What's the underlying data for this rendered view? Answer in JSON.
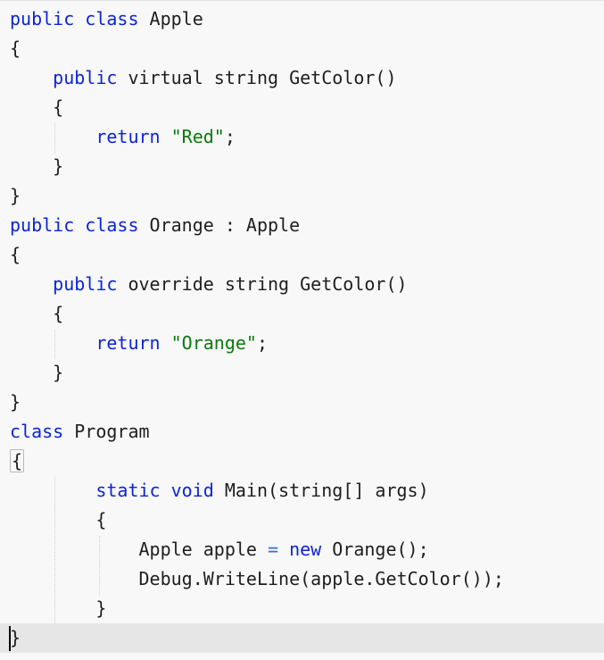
{
  "editor": {
    "lines": [
      {
        "i": 0,
        "tokens": [
          [
            "kw",
            "public"
          ],
          [
            "p",
            " "
          ],
          [
            "kw",
            "class"
          ],
          [
            "p",
            " Apple"
          ]
        ]
      },
      {
        "i": 0,
        "tokens": [
          [
            "p",
            "{"
          ]
        ]
      },
      {
        "i": 1,
        "tokens": [
          [
            "kw",
            "public"
          ],
          [
            "p",
            " virtual string GetColor()"
          ]
        ]
      },
      {
        "i": 1,
        "tokens": [
          [
            "p",
            "{"
          ]
        ]
      },
      {
        "i": 2,
        "tokens": [
          [
            "kw",
            "return"
          ],
          [
            "p",
            " "
          ],
          [
            "str",
            "\"Red\""
          ],
          [
            "p",
            ";"
          ]
        ]
      },
      {
        "i": 1,
        "tokens": [
          [
            "p",
            "}"
          ]
        ]
      },
      {
        "i": 0,
        "tokens": [
          [
            "p",
            "}"
          ]
        ]
      },
      {
        "i": 0,
        "tokens": [
          [
            "kw",
            "public"
          ],
          [
            "p",
            " "
          ],
          [
            "kw",
            "class"
          ],
          [
            "p",
            " Orange : Apple"
          ]
        ]
      },
      {
        "i": 0,
        "tokens": [
          [
            "p",
            "{"
          ]
        ]
      },
      {
        "i": 1,
        "tokens": [
          [
            "kw",
            "public"
          ],
          [
            "p",
            " override string GetColor()"
          ]
        ]
      },
      {
        "i": 1,
        "tokens": [
          [
            "p",
            "{"
          ]
        ]
      },
      {
        "i": 2,
        "tokens": [
          [
            "kw",
            "return"
          ],
          [
            "p",
            " "
          ],
          [
            "str",
            "\"Orange\""
          ],
          [
            "p",
            ";"
          ]
        ]
      },
      {
        "i": 1,
        "tokens": [
          [
            "p",
            "}"
          ]
        ]
      },
      {
        "i": 0,
        "tokens": [
          [
            "p",
            "}"
          ]
        ]
      },
      {
        "i": 0,
        "tokens": [
          [
            "kw",
            "class"
          ],
          [
            "p",
            " Program"
          ]
        ]
      },
      {
        "i": 0,
        "tokens": [
          [
            "box",
            "{"
          ]
        ]
      },
      {
        "i": 2,
        "tokens": [
          [
            "kw",
            "static"
          ],
          [
            "p",
            " "
          ],
          [
            "kw",
            "void"
          ],
          [
            "p",
            " Main(string[] args)"
          ]
        ]
      },
      {
        "i": 2,
        "tokens": [
          [
            "p",
            "{"
          ]
        ]
      },
      {
        "i": 3,
        "tokens": [
          [
            "p",
            "Apple apple "
          ],
          [
            "op",
            "="
          ],
          [
            "p",
            " "
          ],
          [
            "kw",
            "new"
          ],
          [
            "p",
            " Orange();"
          ]
        ]
      },
      {
        "i": 3,
        "tokens": [
          [
            "p",
            "Debug.WriteLine(apple.GetColor());"
          ]
        ]
      },
      {
        "i": 2,
        "tokens": [
          [
            "p",
            "}"
          ]
        ]
      },
      {
        "i": 0,
        "tokens": [
          [
            "p",
            "}"
          ]
        ]
      }
    ]
  },
  "colors": {
    "keyword": "#0b24d6",
    "string": "#0a7a0a",
    "operator": "#3a6ed8",
    "text": "#1e1e1e",
    "background": "#f8f8f8",
    "current_line": "#e6e6e6"
  }
}
